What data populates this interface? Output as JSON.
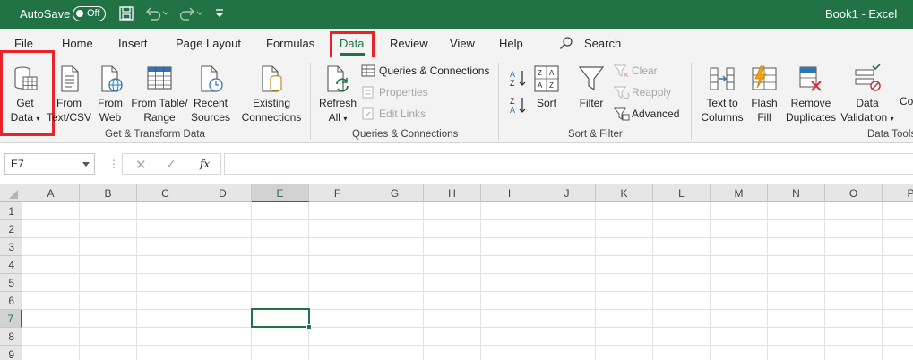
{
  "titlebar": {
    "autosave_label": "AutoSave",
    "autosave_state": "Off",
    "document_title": "Book1  -  Excel",
    "bg_color": "#217346"
  },
  "tabs": [
    {
      "label": "File"
    },
    {
      "label": "Home"
    },
    {
      "label": "Insert"
    },
    {
      "label": "Page Layout"
    },
    {
      "label": "Formulas"
    },
    {
      "label": "Data",
      "active": true
    },
    {
      "label": "Review"
    },
    {
      "label": "View"
    },
    {
      "label": "Help"
    }
  ],
  "search_label": "Search",
  "ribbon": {
    "get_transform": {
      "group_label": "Get & Transform Data",
      "get_data": {
        "line1": "Get",
        "line2": "Data"
      },
      "from_text": {
        "line1": "From",
        "line2": "Text/CSV"
      },
      "from_web": {
        "line1": "From",
        "line2": "Web"
      },
      "from_table": {
        "line1": "From Table/",
        "line2": "Range"
      },
      "recent_sources": {
        "line1": "Recent",
        "line2": "Sources"
      },
      "existing_connections": {
        "line1": "Existing",
        "line2": "Connections"
      }
    },
    "queries": {
      "group_label": "Queries & Connections",
      "refresh": {
        "line1": "Refresh",
        "line2": "All"
      },
      "queries_connections": "Queries & Connections",
      "properties": "Properties",
      "edit_links": "Edit Links"
    },
    "sort_filter": {
      "group_label": "Sort & Filter",
      "sort": "Sort",
      "filter": "Filter",
      "clear": "Clear",
      "reapply": "Reapply",
      "advanced": "Advanced"
    },
    "data_tools": {
      "group_label": "Data Tools",
      "text_to_columns": {
        "line1": "Text to",
        "line2": "Columns"
      },
      "flash_fill": {
        "line1": "Flash",
        "line2": "Fill"
      },
      "remove_duplicates": {
        "line1": "Remove",
        "line2": "Duplicates"
      },
      "data_validation": {
        "line1": "Data",
        "line2": "Validation"
      },
      "consolidate_partial": "Co"
    }
  },
  "formula_bar": {
    "name_box": "E7",
    "fx_label": "fx",
    "formula": ""
  },
  "sheet": {
    "columns": [
      "A",
      "B",
      "C",
      "D",
      "E",
      "F",
      "G",
      "H",
      "I",
      "J",
      "K",
      "L",
      "M",
      "N",
      "O",
      "P"
    ],
    "rows": [
      "1",
      "2",
      "3",
      "4",
      "5",
      "6",
      "7",
      "8",
      "9"
    ],
    "selected_column": "E",
    "selected_row": "7"
  },
  "highlight_color": "#e8232a",
  "accent_color": "#217346"
}
